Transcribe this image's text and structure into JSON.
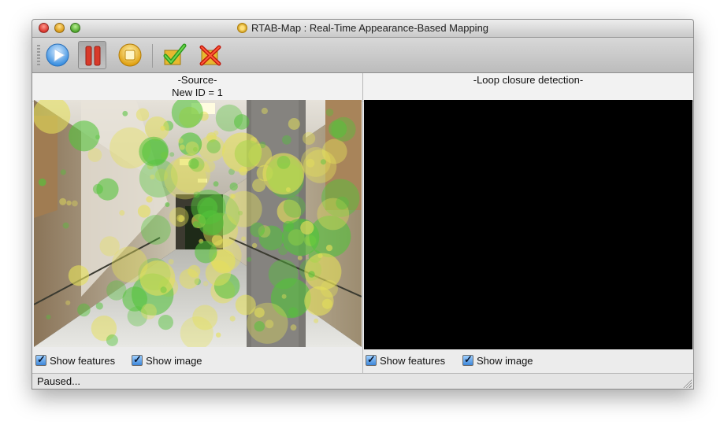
{
  "window": {
    "title": "RTAB-Map : Real-Time Appearance-Based Mapping"
  },
  "toolbar": {
    "buttons": [
      {
        "name": "play",
        "icon": "play-icon"
      },
      {
        "name": "pause",
        "icon": "pause-icon",
        "pressed": true
      },
      {
        "name": "stop",
        "icon": "stop-icon"
      },
      {
        "name": "accept",
        "icon": "checkmark-icon"
      },
      {
        "name": "reject",
        "icon": "red-x-icon"
      }
    ]
  },
  "source_panel": {
    "title": "-Source-",
    "subtitle": "New ID = 1",
    "show_features_label": "Show features",
    "show_features_checked": true,
    "show_image_label": "Show image",
    "show_image_checked": true
  },
  "loop_panel": {
    "title": "-Loop closure detection-",
    "show_features_label": "Show features",
    "show_features_checked": true,
    "show_image_label": "Show image",
    "show_image_checked": true
  },
  "status": {
    "text": "Paused..."
  },
  "colors": {
    "feature_yellow": "#e5e05a",
    "feature_green": "#53c33a",
    "play_blue": "#3a8fe0",
    "pause_red": "#d83a2a",
    "stop_yellow": "#f0c020",
    "check_green": "#3cae2a",
    "x_red": "#e02818"
  }
}
